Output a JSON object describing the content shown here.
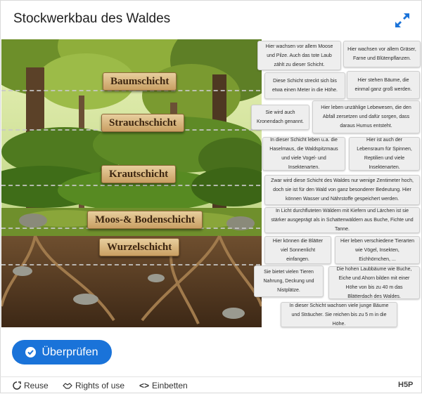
{
  "header": {
    "title": "Stockwerkbau des Waldes",
    "fullscreen_icon": "fullscreen-icon"
  },
  "labels": [
    "Baumschicht",
    "Strauchschicht",
    "Krautschicht",
    "Moos-& Bodenschicht",
    "Wurzelschicht"
  ],
  "cards": [
    "Hier wachsen vor allem Moose und Pilze. Auch das tote Laub zählt zu dieser Schicht.",
    "Hier wachsen vor allem Gräser, Farne und Blütenpflanzen.",
    "Diese Schicht streckt sich bis etwa einen Meter in die Höhe.",
    "Hier stehen Bäume, die einmal ganz groß werden.",
    "Sie wird auch Kronendach genannt.",
    "Hier leben unzählige Lebewesen, die den Abfall zersetzen und dafür sorgen, dass daraus Humus entsteht.",
    "In dieser Schicht leben u.a. die Haselmaus, die Waldspitzmaus und viele Vogel- und Insektenarten.",
    "Hier ist auch der Lebensraum für Spinnen, Reptilien und viele Insektenarten.",
    "Zwar wird diese Schicht des Waldes nur wenige Zentimeter hoch, doch sie ist für den Wald von ganz besonderer Bedeutung. Hier können Wasser und Nährstoffe gespeichert werden.",
    "In Licht durchfluteten Wäldern mit Kiefern und Lärchen ist sie stärker ausgeprägt als in Schattenwäldern aus Buche, Fichte und Tanne.",
    "Hier können die Blätter viel Sonnenlicht einfangen.",
    "Hier leben verschiedene Tierarten wie Vögel, Insekten, Eichhörnchen, ...",
    "Sie bietet vielen Tieren Nahrung, Deckung und Nistplätze.",
    "Die hohen Laubbäume wie Buche, Eiche und Ahorn bilden mit einer Höhe von bis zu 40 m das Blätterdach des Waldes.",
    "In dieser Schicht wachsen viele junge Bäume und Sträucher. Sie reichen bis zu 5 m in die Höhe."
  ],
  "buttons": {
    "check": "Überprüfen"
  },
  "footer": {
    "reuse": "Reuse",
    "rights": "Rights of use",
    "embed": "Einbetten",
    "brand": "H5P"
  },
  "colors": {
    "accent": "#1a73d9"
  }
}
